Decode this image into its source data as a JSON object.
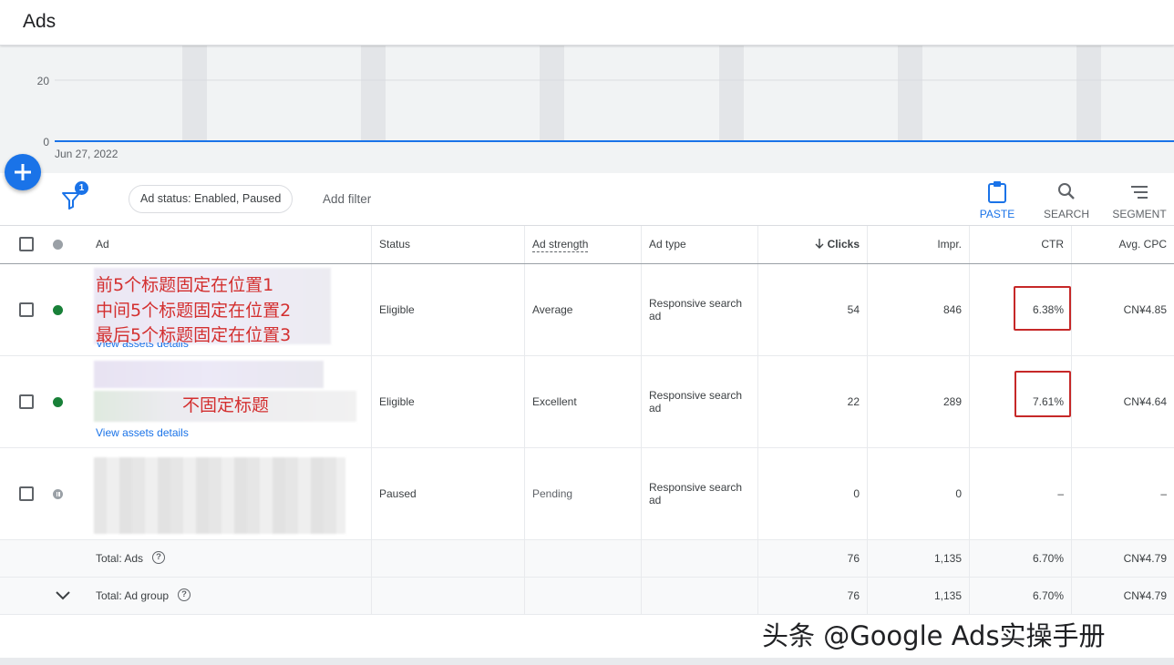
{
  "header": {
    "title": "Ads"
  },
  "chart_data": {
    "type": "line",
    "x": [
      "Jun 27, 2022"
    ],
    "series": [
      {
        "values": [
          0
        ]
      }
    ],
    "yticks": [
      "20",
      "0"
    ],
    "ylim": [
      0,
      20
    ],
    "xlabel_first": "Jun 27, 2022",
    "line_color": "#1a73e8"
  },
  "toolbar": {
    "filter_badge": "1",
    "status_chip": "Ad status: Enabled, Paused",
    "add_filter": "Add filter",
    "paste": "PASTE",
    "search": "SEARCH",
    "segment": "SEGMENT"
  },
  "table": {
    "headers": {
      "ad": "Ad",
      "status": "Status",
      "strength": "Ad strength",
      "type": "Ad type",
      "clicks": "Clicks",
      "impr": "Impr.",
      "ctr": "CTR",
      "cpc": "Avg. CPC"
    },
    "rows": [
      {
        "annot_1": "前5个标题固定在位置1",
        "annot_2": "中间5个标题固定在位置2",
        "annot_3": "最后5个标题固定在位置3",
        "link": "View assets details",
        "status": "Eligible",
        "strength": "Average",
        "type_1": "Responsive search",
        "type_2": "ad",
        "clicks": "54",
        "impr": "846",
        "ctr": "6.38%",
        "cpc": "CN¥4.85"
      },
      {
        "annot_1": "不固定标题",
        "link": "View assets details",
        "status": "Eligible",
        "strength": "Excellent",
        "type_1": "Responsive search",
        "type_2": "ad",
        "clicks": "22",
        "impr": "289",
        "ctr": "7.61%",
        "cpc": "CN¥4.64"
      },
      {
        "status": "Paused",
        "strength": "Pending",
        "type_1": "Responsive search",
        "type_2": "ad",
        "clicks": "0",
        "impr": "0",
        "ctr": "–",
        "cpc": "–"
      }
    ],
    "total_ads": {
      "label": "Total: Ads",
      "clicks": "76",
      "impr": "1,135",
      "ctr": "6.70%",
      "cpc": "CN¥4.79"
    },
    "total_group": {
      "label": "Total: Ad group",
      "clicks": "76",
      "impr": "1,135",
      "ctr": "6.70%",
      "cpc": "CN¥4.79"
    }
  },
  "watermark": "头条 @Google Ads实操手册",
  "colors": {
    "accent": "#1a73e8",
    "enabled": "#188038",
    "highlight": "#c62828",
    "annotation": "#d32f2f"
  }
}
